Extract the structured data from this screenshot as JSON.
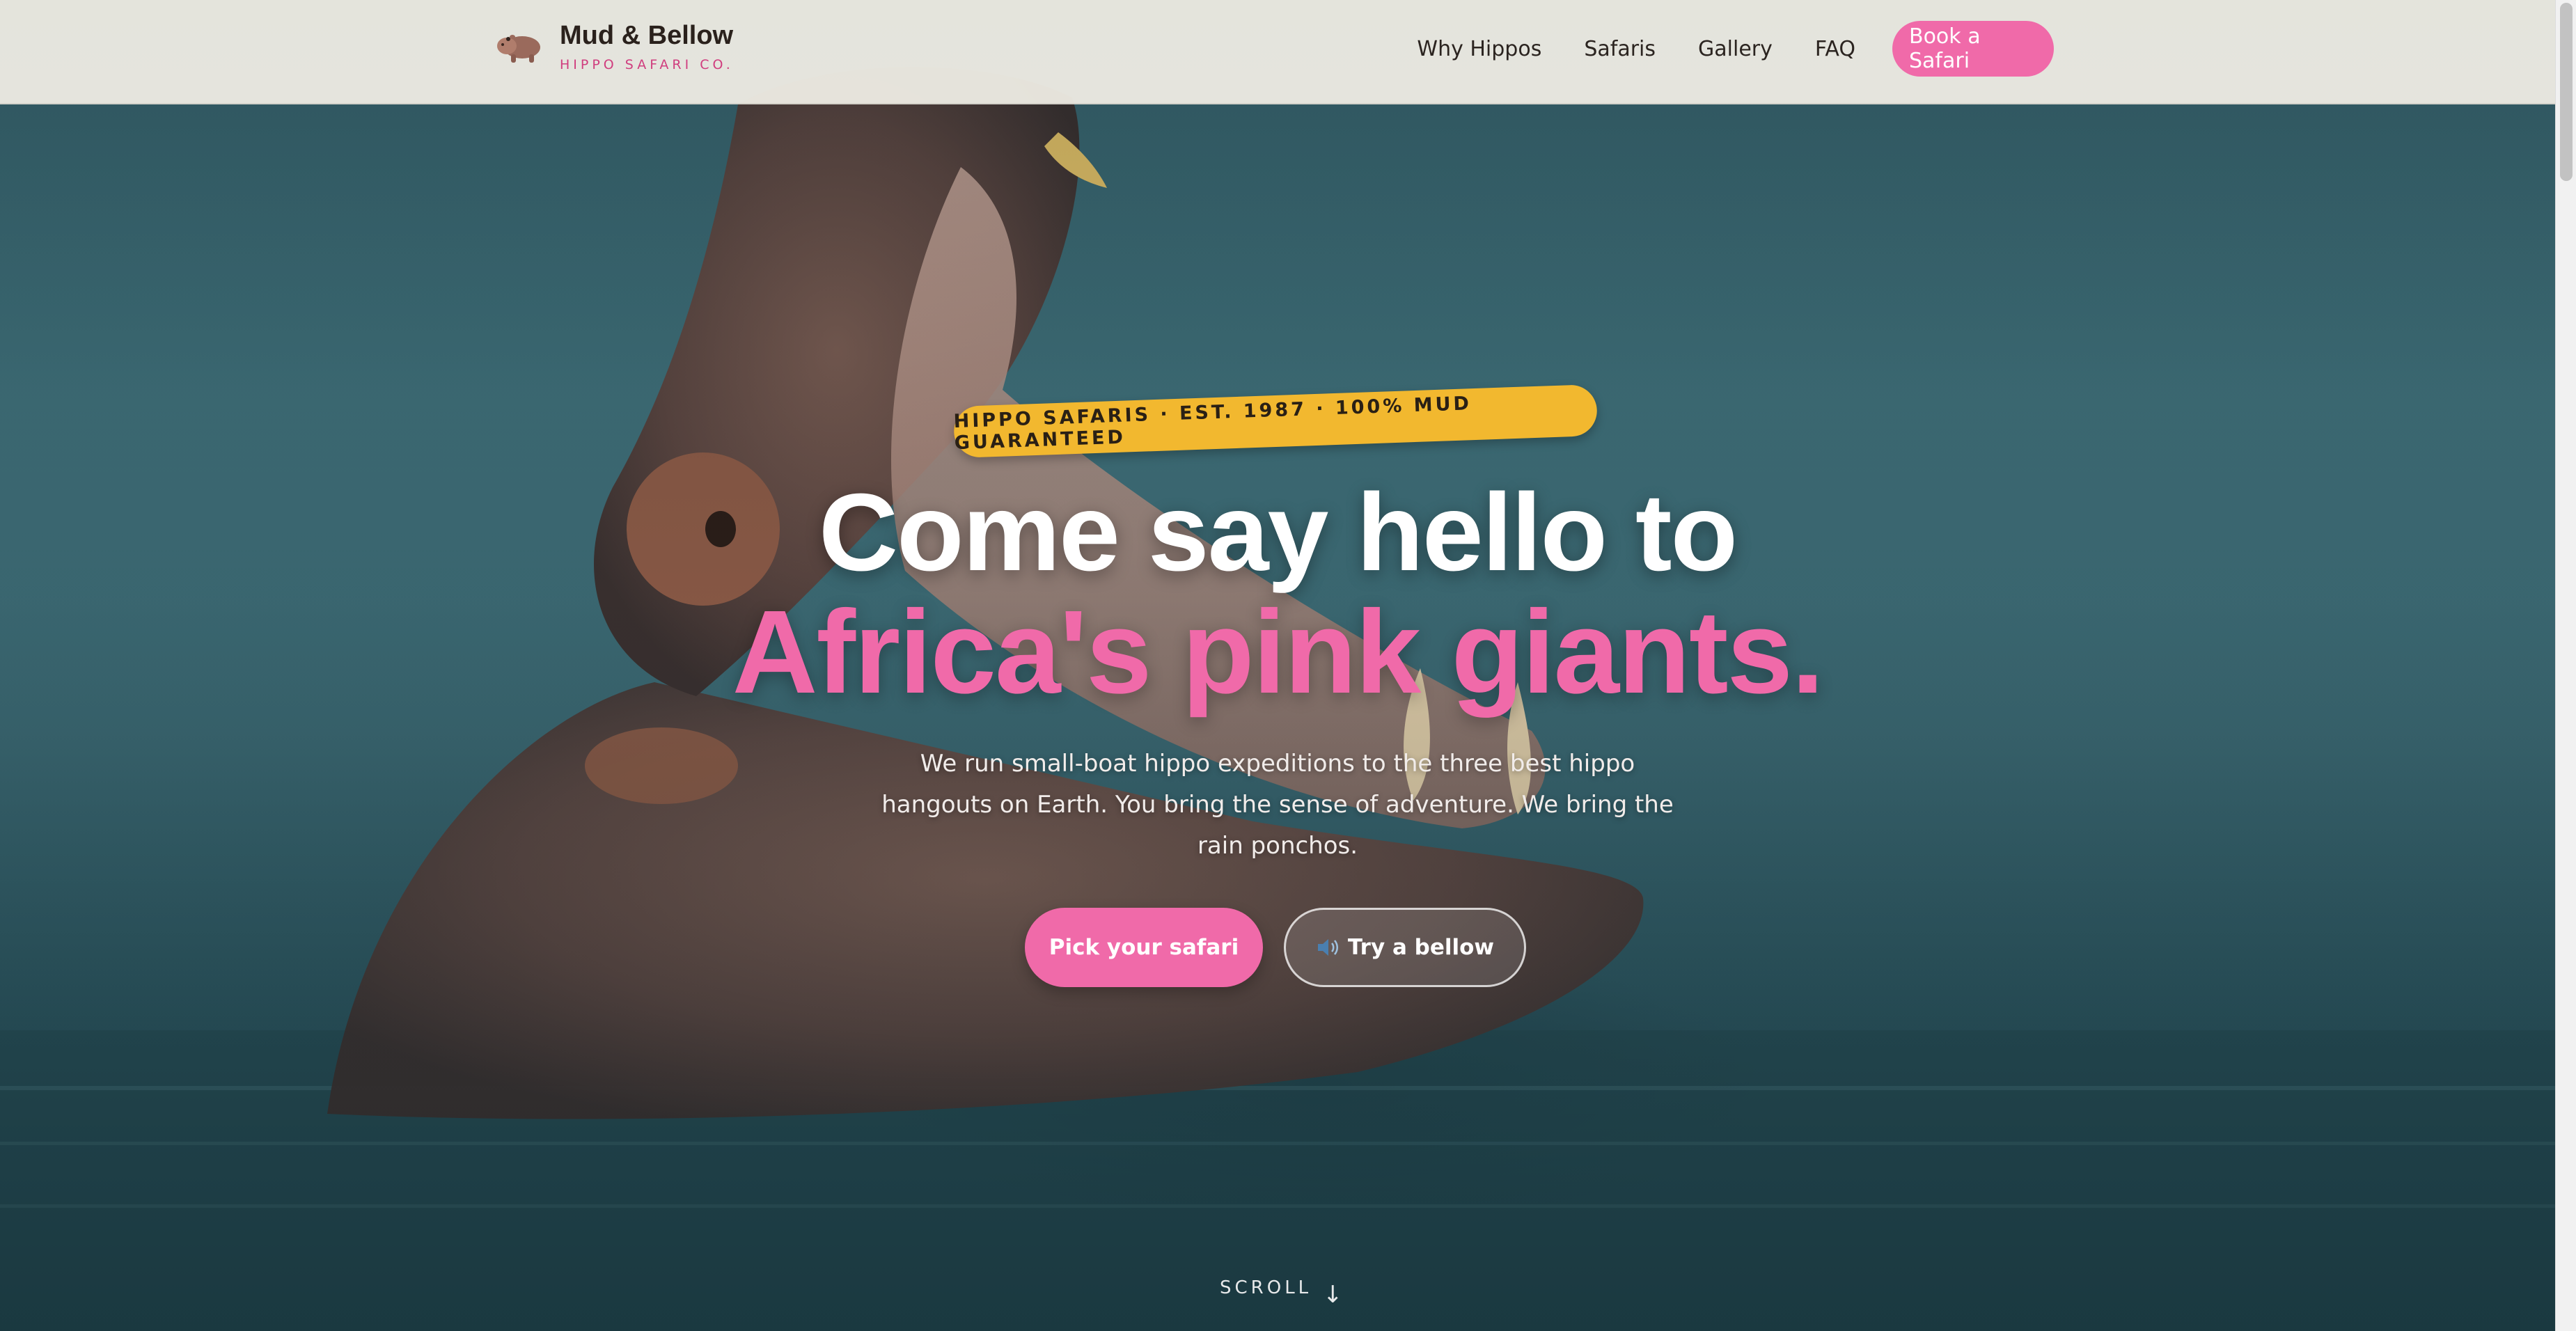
{
  "brand": {
    "name": "Mud & Bellow",
    "tagline": "HIPPO SAFARI CO.",
    "logo_icon": "hippo-icon"
  },
  "nav": {
    "items": [
      {
        "label": "Why Hippos"
      },
      {
        "label": "Safaris"
      },
      {
        "label": "Gallery"
      },
      {
        "label": "FAQ"
      }
    ],
    "cta_label": "Book a Safari"
  },
  "hero": {
    "badge": "HIPPO SAFARIS · EST. 1987 · 100% MUD GUARANTEED",
    "headline_line1": "Come say hello to",
    "headline_line2": "Africa's pink giants.",
    "subtitle": "We run small-boat hippo expeditions to the three best hippo hangouts on Earth. You bring the sense of adventure. We bring the rain ponchos.",
    "primary_button": "Pick your safari",
    "secondary_button": "Try a bellow",
    "secondary_button_icon": "speaker-icon",
    "scroll_label": "SCROLL",
    "scroll_icon": "arrow-down-icon",
    "scroll_arrow": "↓"
  },
  "colors": {
    "accent_pink": "#f06aa9",
    "badge_yellow": "#f2b82f",
    "header_bg": "#eceae2",
    "water": "#3f6f79"
  }
}
